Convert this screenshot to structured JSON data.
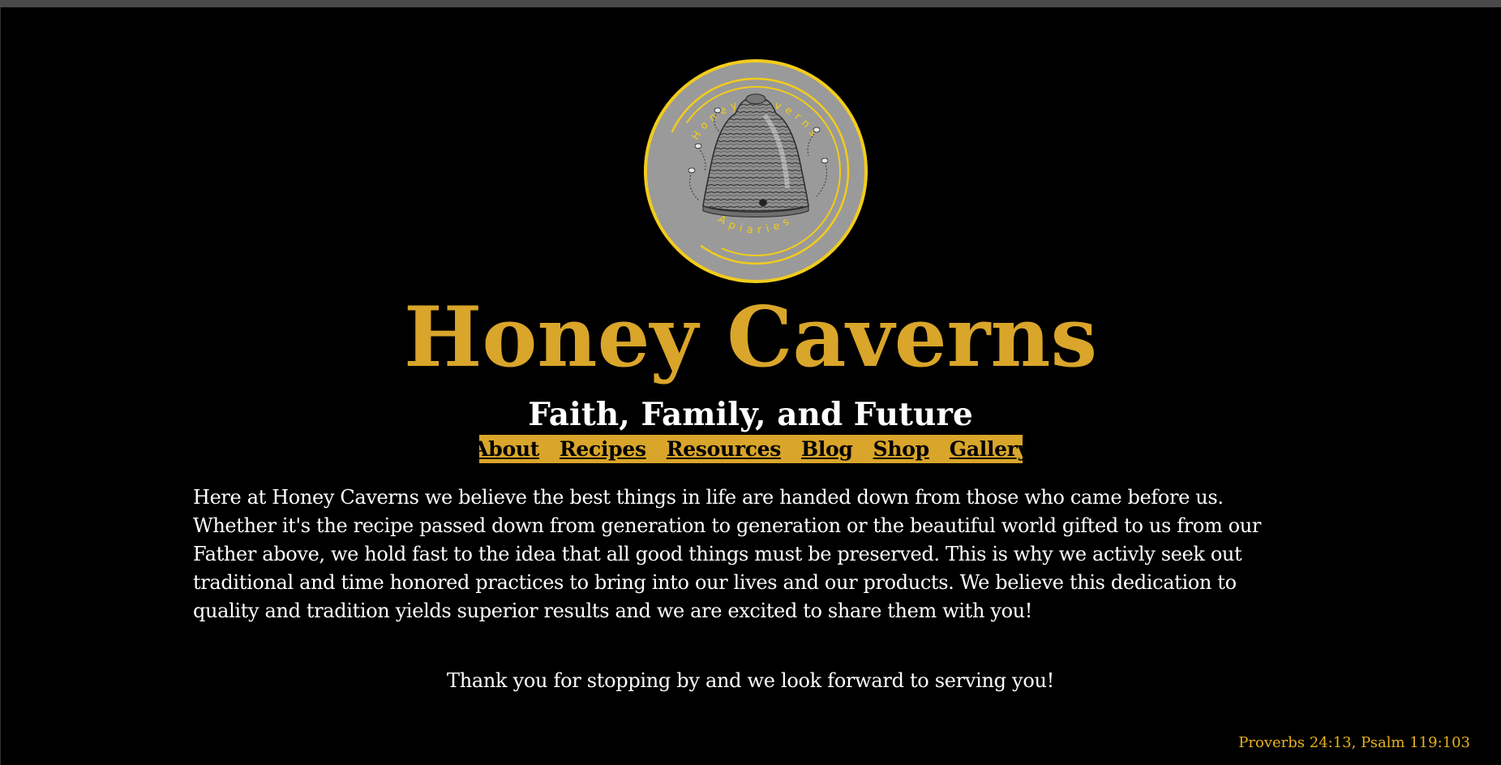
{
  "site": {
    "title": "Honey Caverns",
    "tagline": "Faith, Family, and Future"
  },
  "logo": {
    "top_text": "Honey Caverns",
    "bottom_text": "Apiaries",
    "ring_color": "#f2cc1b",
    "fill_color": "#9a9a9a"
  },
  "nav": {
    "items": [
      {
        "label": "About"
      },
      {
        "label": "Recipes"
      },
      {
        "label": "Resources"
      },
      {
        "label": "Blog"
      },
      {
        "label": "Shop"
      },
      {
        "label": "Gallery"
      }
    ]
  },
  "content": {
    "intro": "Here at Honey Caverns we believe the best things in life are handed down from those who came before us. Whether it's the recipe passed down from generation to generation or the beautiful world gifted to us from our Father above, we hold fast to the idea that all good things must be preserved. This is why we activly seek out traditional and time honored practices to bring into our lives and our products. We believe this dedication to quality and tradition yields superior results and we are excited to share them with you!",
    "thanks": "Thank you for stopping by and we look forward to serving you!"
  },
  "footer": {
    "verse": "Proverbs 24:13, Psalm 119:103"
  },
  "colors": {
    "background": "#000000",
    "accent_gold": "#d9a52a",
    "verse_gold": "#e8b31d",
    "text": "#ffffff"
  }
}
